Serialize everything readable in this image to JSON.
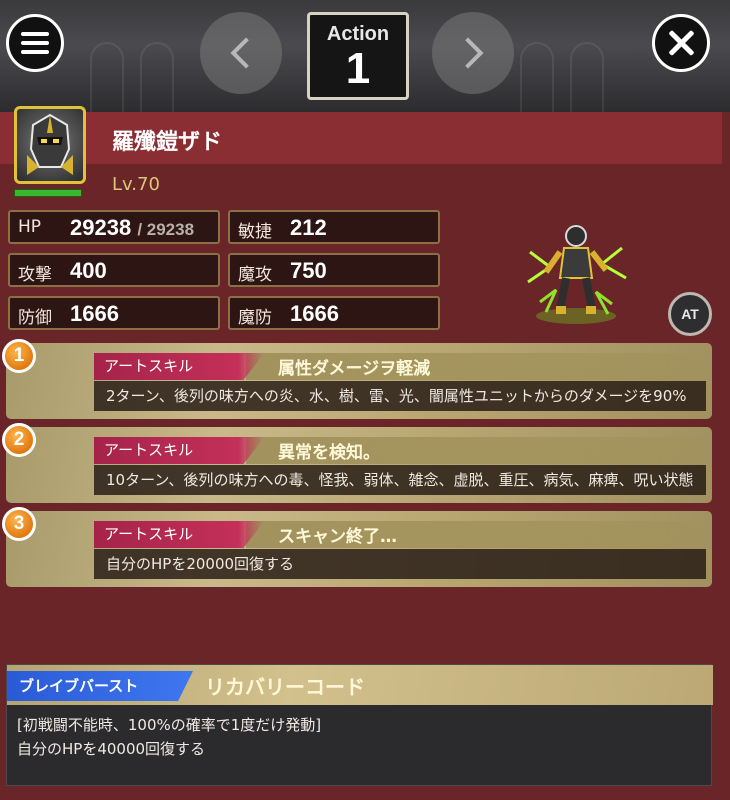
{
  "header": {
    "action_label": "Action",
    "action_number": "1",
    "menu_icon": "menu-icon",
    "close_icon": "close-icon",
    "prev_icon": "chevron-left-icon",
    "next_icon": "chevron-right-icon"
  },
  "unit": {
    "name": "羅殲鎧ザド",
    "level": "Lv.70",
    "hp_bar_fraction": 1.0,
    "badge": "AT",
    "stats": {
      "hp": {
        "label": "HP",
        "value": "29238",
        "max": "/ 29238"
      },
      "agility": {
        "label": "敏捷",
        "value": "212"
      },
      "attack": {
        "label": "攻撃",
        "value": "400"
      },
      "magic_attack": {
        "label": "魔攻",
        "value": "750"
      },
      "defense": {
        "label": "防御",
        "value": "1666"
      },
      "magic_defense": {
        "label": "魔防",
        "value": "1666"
      }
    }
  },
  "skills": [
    {
      "number": "1",
      "type": "アートスキル",
      "title": "属性ダメージヲ軽減",
      "desc": "2ターン、後列の味方への炎、水、樹、雷、光、闇属性ユニットからのダメージを90%"
    },
    {
      "number": "2",
      "type": "アートスキル",
      "title": "異常を検知。",
      "desc": "10ターン、後列の味方への毒、怪我、弱体、雑念、虚脱、重圧、病気、麻痺、呪い状態"
    },
    {
      "number": "3",
      "type": "アートスキル",
      "title": "スキャン終了…",
      "desc": "自分のHPを20000回復する"
    }
  ],
  "brave_burst": {
    "label": "ブレイブバースト",
    "title": "リカバリーコード",
    "line1": "[初戦闘不能時、100%の確率で1度だけ発動]",
    "line2": "自分のHPを40000回復する"
  },
  "colors": {
    "background": "#6a2529",
    "name_bar": "#8a2e33",
    "level_text": "#d9c879",
    "skill_type_bg": "#a5234a",
    "brave_burst_label_bg": "#2a5bd6",
    "number_badge": "#e07a10"
  }
}
